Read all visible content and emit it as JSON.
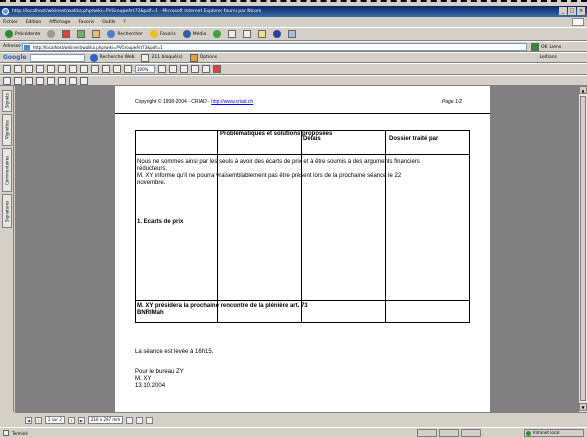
{
  "window": {
    "title": "http://localhost/wikinest/walika.php/wiki=PVGroupeArt73&pdf=1 - Microsoft Internet Explorer fourni par Nicom"
  },
  "menubar": {
    "items": [
      "Fichier",
      "Edition",
      "Affichage",
      "Favoris",
      "Outils",
      "?"
    ]
  },
  "toolbar": {
    "back_label": "Précédente",
    "search_label": "Rechercher",
    "favorites_label": "Favoris",
    "media_label": "Média"
  },
  "address": {
    "label": "Adresse",
    "value": "http://localhost/wikinest/walika.php/wiki=PVGroupeArt73&pdf=1",
    "go_label": "OK",
    "links_label": "Liens"
  },
  "google": {
    "logo": "Google",
    "search_web_label": "Recherche Web",
    "blocked_label": "211 bloqué(s)",
    "options_label": "Options",
    "settings_label": "Leltians"
  },
  "pdf": {
    "zoom": "100%"
  },
  "side_tabs": [
    "Signets",
    "Vignettes",
    "Commentaires",
    "Signatures"
  ],
  "page": {
    "copyright_prefix": "Copyright © 1998-2004 - CRIAD - ",
    "copyright_link": "http://www.criad.ch",
    "page_number": "Page 1/2",
    "columns": {
      "col2": "Problématiques et solutions proposées",
      "col2_overlap": "Délais",
      "col3": "Dossier traité par"
    },
    "intro_lines": [
      "Nous ne sommes ainsi par les seuls à avoir des écarts de prix et à être soumis à des arguments financiers",
      "réducteurs.",
      "M. XY informe qu'il ne pourra vraisemblablement pas être présent lors de la prochaine séance le 22",
      "novembre."
    ],
    "section_heading": "1. Ecarts de prix",
    "meeting_note": "M. XY présidera la prochaine rencontre de la plénière art. 73",
    "overlap_label": "BNRIMah",
    "closing_line": "La séance est levée à 16h15.",
    "signature_lines": [
      "Pour le bureau ZY",
      "M. XY",
      "13.10.2004"
    ]
  },
  "nav": {
    "page_indicator": "2 sur 2",
    "page_size": "210 x 297 mm"
  },
  "status": {
    "done_label": "Terminé",
    "zone_label": "Intranet local"
  }
}
